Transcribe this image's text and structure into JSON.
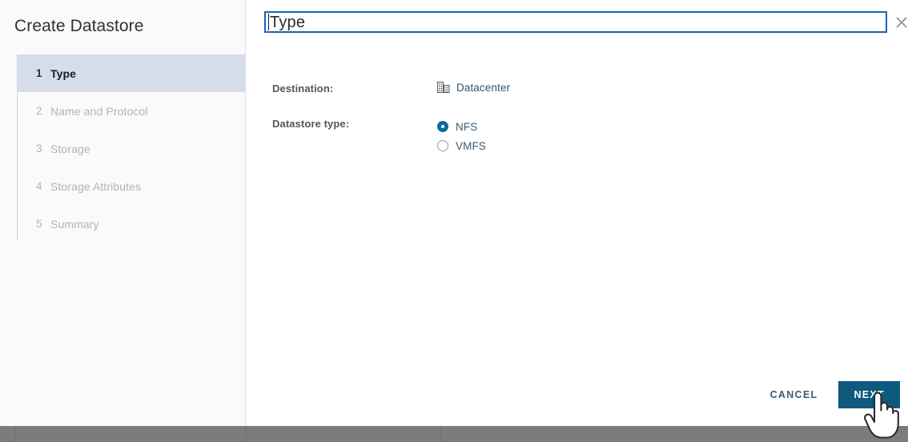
{
  "window": {
    "title": "Create Datastore"
  },
  "sidebar": {
    "title": "Create Datastore",
    "steps": [
      {
        "num": "1",
        "label": "Type",
        "state": "active"
      },
      {
        "num": "2",
        "label": "Name and Protocol",
        "state": "pending"
      },
      {
        "num": "3",
        "label": "Storage",
        "state": "pending"
      },
      {
        "num": "4",
        "label": "Storage Attributes",
        "state": "pending"
      },
      {
        "num": "5",
        "label": "Summary",
        "state": "pending"
      }
    ]
  },
  "header": {
    "page_title": "Type",
    "close_icon": "close-icon"
  },
  "form": {
    "destination": {
      "label": "Destination:",
      "icon": "datacenter-icon",
      "value": "Datacenter"
    },
    "datastore_type": {
      "label": "Datastore type:",
      "options": [
        {
          "label": "NFS",
          "checked": true
        },
        {
          "label": "VMFS",
          "checked": false
        }
      ]
    }
  },
  "footer": {
    "cancel_label": "CANCEL",
    "next_label": "NEXT"
  },
  "colors": {
    "accent_primary": "#0e5a7d",
    "radio_selected": "#0b6a9c",
    "focus_border": "#1864b8",
    "step_active_bg": "#d4dde9",
    "sidebar_bg": "#fafafa",
    "bottom_bar": "#7c7c7c",
    "label_text": "#565656",
    "muted_step_text": "#b3b3b3"
  }
}
